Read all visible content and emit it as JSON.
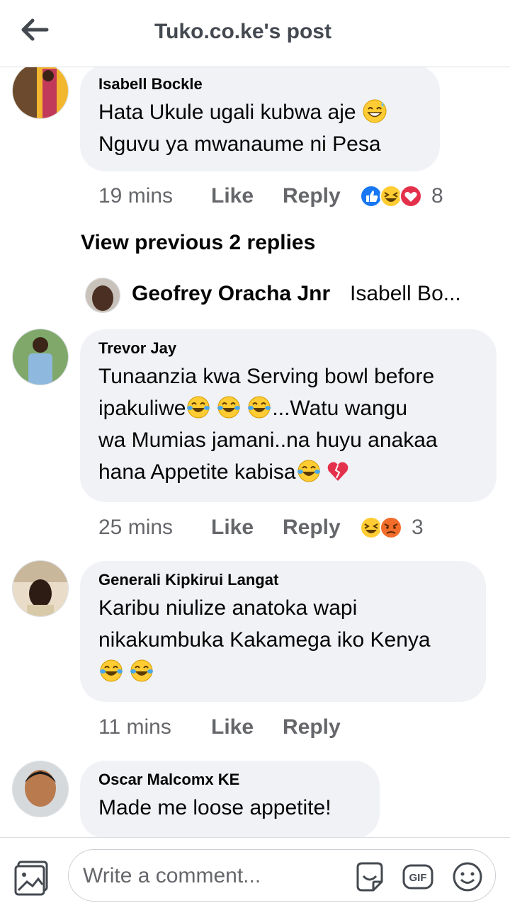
{
  "header": {
    "title": "Tuko.co.ke's post"
  },
  "comments": [
    {
      "author": "Isabell Bockle",
      "lines": [
        "Hata Ukule ugali kubwa aje",
        "Nguvu ya mwanaume ni Pesa"
      ],
      "time": "19 mins",
      "like": "Like",
      "reply": "Reply",
      "reactions": [
        "like",
        "haha",
        "love"
      ],
      "reaction_count": "8"
    },
    {
      "author": "Trevor Jay",
      "lines": [
        "Tunaanzia kwa Serving bowl before",
        "ipakuliwe",
        "...Watu wangu",
        "wa Mumias jamani..na huyu anakaa",
        "hana Appetite kabisa"
      ],
      "time": "25 mins",
      "like": "Like",
      "reply": "Reply",
      "reactions": [
        "haha",
        "angry"
      ],
      "reaction_count": "3"
    },
    {
      "author": "Generali Kipkirui Langat",
      "lines": [
        "Karibu niulize anatoka wapi",
        "nikakumbuka Kakamega iko Kenya"
      ],
      "time": "11 mins",
      "like": "Like",
      "reply": "Reply"
    },
    {
      "author": "Oscar Malcomx KE",
      "lines": [
        "Made me loose appetite!"
      ]
    }
  ],
  "replies": {
    "view_previous": "View previous 2 replies",
    "latest_author": "Geofrey Oracha Jnr",
    "latest_text": "Isabell Bo..."
  },
  "composer": {
    "placeholder": "Write a comment...",
    "gif_label": "GIF"
  },
  "colors": {
    "bubble": "#f0f2f5",
    "meta": "#65676b",
    "like_blue": "#1877f2",
    "emoji_yellow": "#ffcc33",
    "heart_red": "#e4314b"
  }
}
